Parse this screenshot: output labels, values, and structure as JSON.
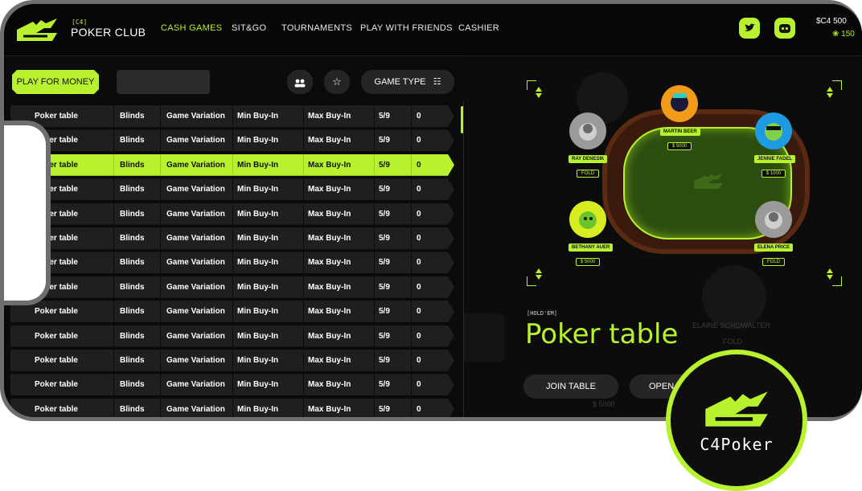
{
  "header": {
    "brand_sub": "[C4]",
    "brand": "POKER CLUB",
    "nav": [
      "CASH GAMES",
      "SIT&GO",
      "TOURNAMENTS",
      "PLAY WITH FRIENDS",
      "CASHIER"
    ],
    "balance": "$C4 500",
    "chips": "❀ 150"
  },
  "toolbar": {
    "play_money": "PLAY FOR MONEY",
    "game_type": "GAME TYPE"
  },
  "table_rows": [
    [
      "Poker table",
      "Blinds",
      "Game Variation",
      "Min Buy-In",
      "Max Buy-In",
      "5/9",
      "0"
    ],
    [
      "Poker table",
      "Blinds",
      "Game Variation",
      "Min Buy-In",
      "Max Buy-In",
      "5/9",
      "0"
    ],
    [
      "Poker table",
      "Blinds",
      "Game Variation",
      "Min Buy-In",
      "Max Buy-In",
      "5/9",
      "0"
    ],
    [
      "Poker table",
      "Blinds",
      "Game Variation",
      "Min Buy-In",
      "Max Buy-In",
      "5/9",
      "0"
    ],
    [
      "Poker table",
      "Blinds",
      "Game Variation",
      "Min Buy-In",
      "Max Buy-In",
      "5/9",
      "0"
    ],
    [
      "Poker table",
      "Blinds",
      "Game Variation",
      "Min Buy-In",
      "Max Buy-In",
      "5/9",
      "0"
    ],
    [
      "Poker table",
      "Blinds",
      "Game Variation",
      "Min Buy-In",
      "Max Buy-In",
      "5/9",
      "0"
    ],
    [
      "Poker table",
      "Blinds",
      "Game Variation",
      "Min Buy-In",
      "Max Buy-In",
      "5/9",
      "0"
    ],
    [
      "Poker table",
      "Blinds",
      "Game Variation",
      "Min Buy-In",
      "Max Buy-In",
      "5/9",
      "0"
    ],
    [
      "Poker table",
      "Blinds",
      "Game Variation",
      "Min Buy-In",
      "Max Buy-In",
      "5/9",
      "0"
    ],
    [
      "Poker table",
      "Blinds",
      "Game Variation",
      "Min Buy-In",
      "Max Buy-In",
      "5/9",
      "0"
    ],
    [
      "Poker table",
      "Blinds",
      "Game Variation",
      "Min Buy-In",
      "Max Buy-In",
      "5/9",
      "0"
    ],
    [
      "Poker table",
      "Blinds",
      "Game Variation",
      "Min Buy-In",
      "Max Buy-In",
      "5/9",
      "0"
    ]
  ],
  "players": {
    "martin": {
      "name": "MARTIN BEER",
      "stack": "$ 5000"
    },
    "ray": {
      "name": "RAY DENESIK",
      "status": "FOLD"
    },
    "jennie": {
      "name": "JENNIE FADEL",
      "stack": "$ 1000"
    },
    "bethany": {
      "name": "BETHANY AUER",
      "stack": "$ 5000"
    },
    "elena": {
      "name": "ELENA PRICE",
      "status": "FOLD"
    }
  },
  "detail": {
    "game_kind": "[HOLD'EM]",
    "title": "Poker table",
    "join": "JOIN TABLE",
    "open": "OPEN T"
  },
  "background": {
    "elaine": "ELAINE SCHOWALTER",
    "fold": "FOLD",
    "stack": "$ 5000",
    "martin": "MARTIN BEER"
  },
  "badge": {
    "text": "C4Poker"
  },
  "colors": {
    "accent": "#b8f22e",
    "bg": "#0a0a0a"
  }
}
